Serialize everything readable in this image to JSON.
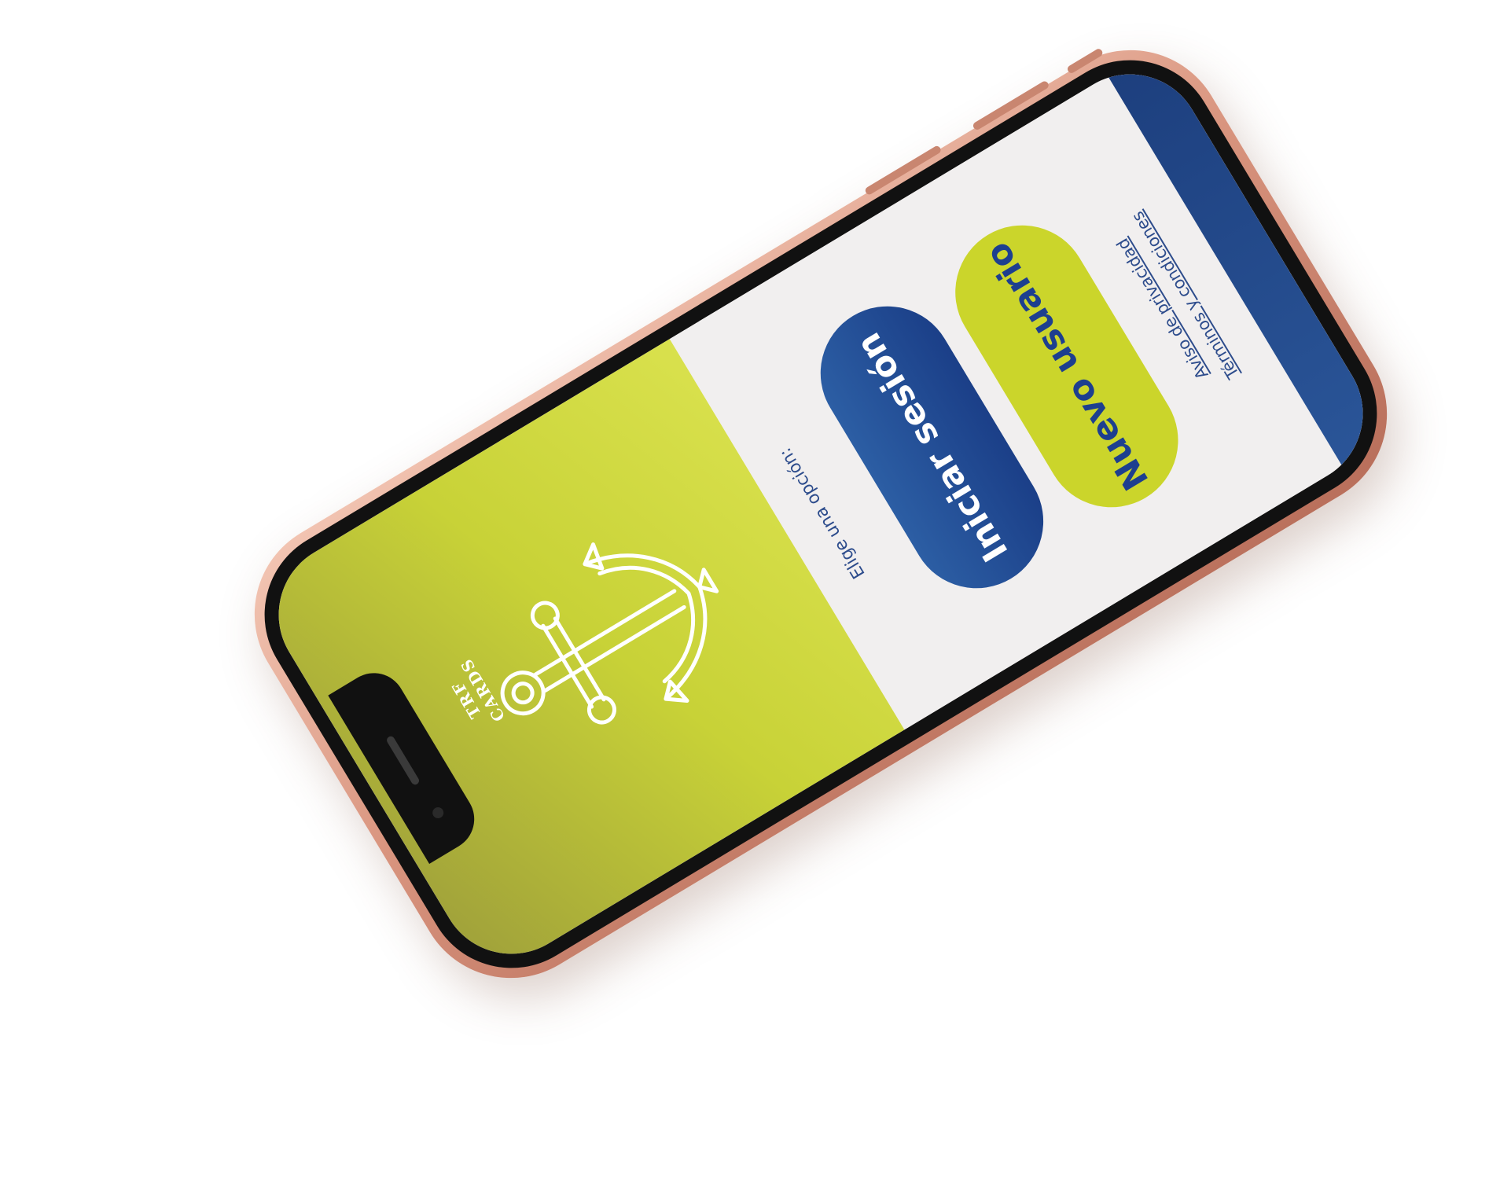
{
  "brand": {
    "name": "TRF CARDS"
  },
  "screen": {
    "prompt": "Elige una opción:",
    "login_button": "Iniciar sesión",
    "new_user_button": "Nuevo usuario",
    "privacy_link": "Aviso de privacidad",
    "terms_link": "Términos y condiciones"
  },
  "colors": {
    "accent_lime": "#cbd52b",
    "brand_blue": "#1d3f8f",
    "background": "#f1efef",
    "phone_frame": "#d9957f"
  },
  "icons": {
    "logo": "anchor-icon"
  }
}
